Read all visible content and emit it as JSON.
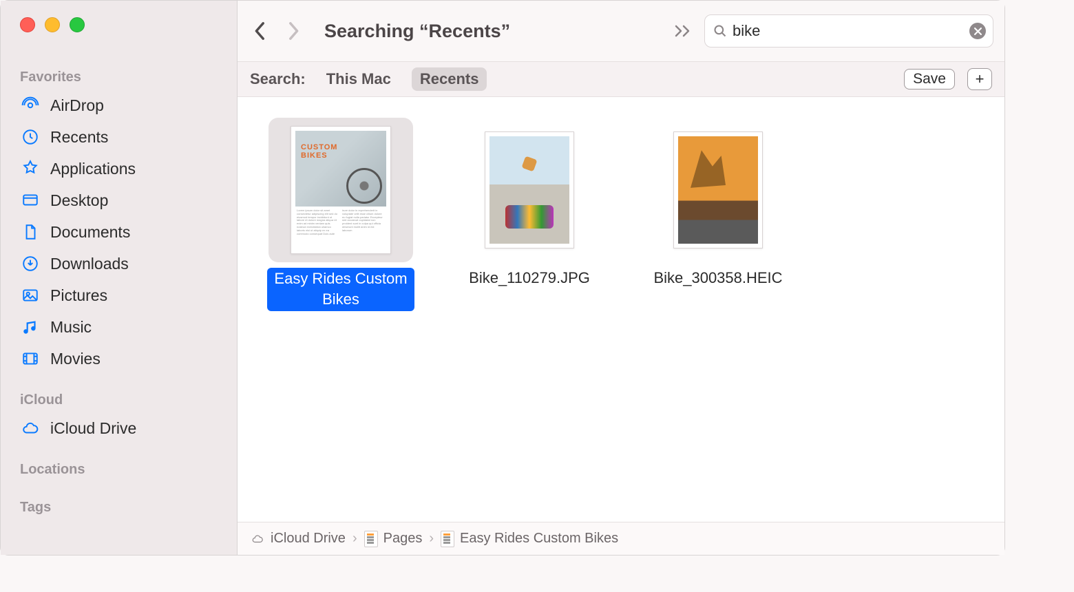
{
  "sidebar": {
    "sections": {
      "favorites_label": "Favorites",
      "icloud_label": "iCloud",
      "locations_label": "Locations",
      "tags_label": "Tags"
    },
    "favorites": [
      {
        "label": "AirDrop"
      },
      {
        "label": "Recents"
      },
      {
        "label": "Applications"
      },
      {
        "label": "Desktop"
      },
      {
        "label": "Documents"
      },
      {
        "label": "Downloads"
      },
      {
        "label": "Pictures"
      },
      {
        "label": "Music"
      },
      {
        "label": "Movies"
      }
    ],
    "icloud": [
      {
        "label": "iCloud Drive"
      }
    ]
  },
  "toolbar": {
    "title": "Searching “Recents”"
  },
  "search": {
    "value": "bike"
  },
  "scope": {
    "label": "Search:",
    "options": [
      {
        "label": "This Mac",
        "active": false
      },
      {
        "label": "Recents",
        "active": true
      }
    ],
    "save_label": "Save"
  },
  "results": [
    {
      "label_line1": "Easy Rides Custom",
      "label_line2": "Bikes",
      "selected": true,
      "kind": "doc",
      "doc_title": "CUSTOM\nBIKES"
    },
    {
      "label_line1": "Bike_110279.JPG",
      "label_line2": "",
      "selected": false,
      "kind": "bmx"
    },
    {
      "label_line1": "Bike_300358.HEIC",
      "label_line2": "",
      "selected": false,
      "kind": "sunset"
    }
  ],
  "pathbar": {
    "crumbs": [
      {
        "label": "iCloud Drive"
      },
      {
        "label": "Pages"
      },
      {
        "label": "Easy Rides Custom Bikes"
      }
    ]
  }
}
